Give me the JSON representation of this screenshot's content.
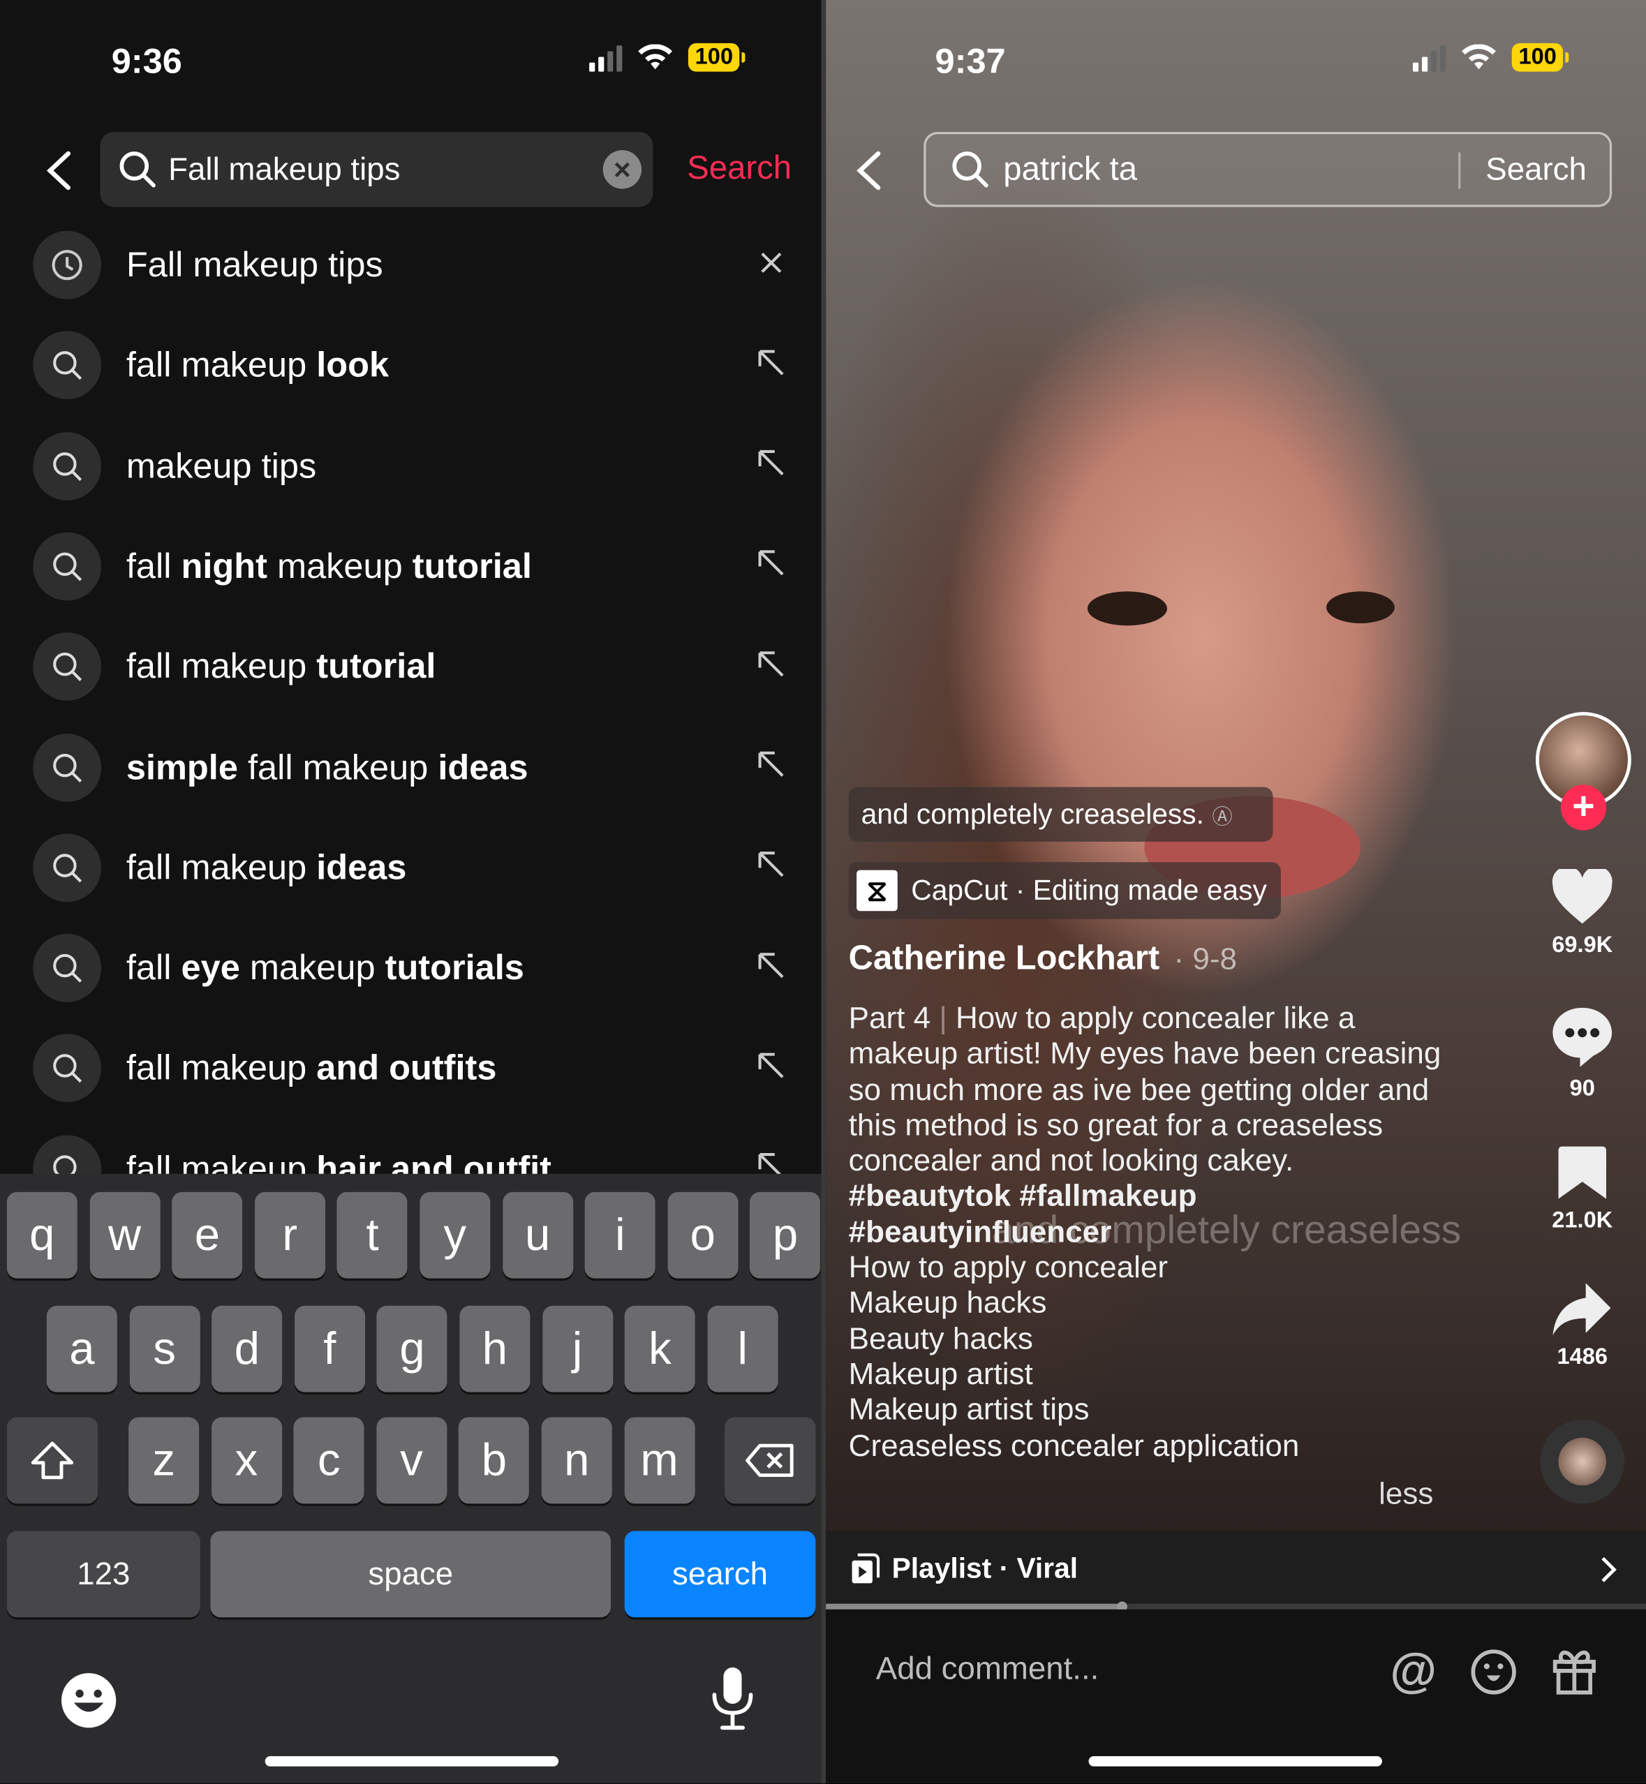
{
  "left": {
    "status": {
      "time": "9:36",
      "battery": "100"
    },
    "search": {
      "query": "Fall makeup tips",
      "button": "Search"
    },
    "suggestions": [
      {
        "type": "history",
        "parts": [
          {
            "t": "Fall makeup tips",
            "b": false
          }
        ]
      },
      {
        "type": "search",
        "parts": [
          {
            "t": "fall makeup ",
            "b": false
          },
          {
            "t": "look",
            "b": true
          }
        ]
      },
      {
        "type": "search",
        "parts": [
          {
            "t": "makeup tips",
            "b": false
          }
        ]
      },
      {
        "type": "search",
        "parts": [
          {
            "t": "fall ",
            "b": false
          },
          {
            "t": "night",
            "b": true
          },
          {
            "t": " makeup ",
            "b": false
          },
          {
            "t": "tutorial",
            "b": true
          }
        ]
      },
      {
        "type": "search",
        "parts": [
          {
            "t": "fall makeup ",
            "b": false
          },
          {
            "t": "tutorial",
            "b": true
          }
        ]
      },
      {
        "type": "search",
        "parts": [
          {
            "t": "simple",
            "b": true
          },
          {
            "t": " fall makeup ",
            "b": false
          },
          {
            "t": "ideas",
            "b": true
          }
        ]
      },
      {
        "type": "search",
        "parts": [
          {
            "t": "fall makeup ",
            "b": false
          },
          {
            "t": "ideas",
            "b": true
          }
        ]
      },
      {
        "type": "search",
        "parts": [
          {
            "t": "fall ",
            "b": false
          },
          {
            "t": "eye",
            "b": true
          },
          {
            "t": " makeup ",
            "b": false
          },
          {
            "t": "tutorials",
            "b": true
          }
        ]
      },
      {
        "type": "search",
        "parts": [
          {
            "t": "fall makeup ",
            "b": false
          },
          {
            "t": "and outfits",
            "b": true
          }
        ]
      },
      {
        "type": "search",
        "parts": [
          {
            "t": "fall makeup ",
            "b": false
          },
          {
            "t": "hair and outfit",
            "b": true
          }
        ]
      }
    ],
    "keyboard": {
      "rows": [
        [
          "q",
          "w",
          "e",
          "r",
          "t",
          "y",
          "u",
          "i",
          "o",
          "p"
        ],
        [
          "a",
          "s",
          "d",
          "f",
          "g",
          "h",
          "j",
          "k",
          "l"
        ],
        [
          "z",
          "x",
          "c",
          "v",
          "b",
          "n",
          "m"
        ]
      ],
      "numbers": "123",
      "space": "space",
      "search": "search",
      "search_color": "#0a84ff"
    }
  },
  "right": {
    "status": {
      "time": "9:37",
      "battery": "100"
    },
    "search": {
      "query": "patrick ta",
      "button": "Search"
    },
    "caption_overlay": "and completely creaseless.",
    "capcut": "CapCut · Editing made easy",
    "author": "Catherine Lockhart",
    "date": "· 9-8",
    "description": {
      "part": "Part 4",
      "sep": "|",
      "text": " How to apply concealer like a makeup artist! My eyes have been creasing so much more as ive bee getting older and this method is so great for a creaseless concealer and not looking cakey. ",
      "hashtags": "#beautytok #fallmakeup #beautyinfluencer",
      "lines": [
        "How to apply concealer",
        "Makeup hacks",
        "Beauty hacks",
        "Makeup artist",
        "Makeup artist tips",
        "Creaseless concealer application"
      ],
      "less": "less"
    },
    "burned_subtitle": "and completely creaseless",
    "likes": "69.9K",
    "comments": "90",
    "saves": "21.0K",
    "shares": "1486",
    "playlist": "Playlist · Viral",
    "progress_percent": 36,
    "comment_placeholder": "Add comment...",
    "accent": "#fe2c55"
  }
}
